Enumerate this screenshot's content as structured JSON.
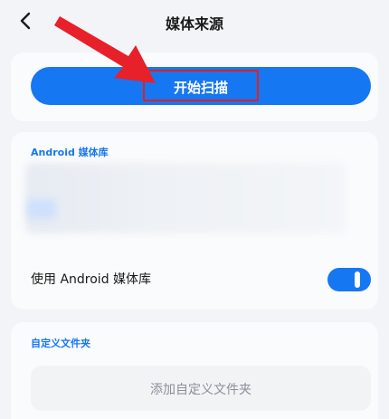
{
  "header": {
    "title": "媒体来源",
    "back_icon": "chevron-left-icon"
  },
  "scan": {
    "button_label": "开始扫描",
    "accent": "#1677f2",
    "highlight_color": "#e02020"
  },
  "android_library": {
    "section_label": "Android 媒体库",
    "toggle_label": "使用 Android 媒体库",
    "toggle_on": true
  },
  "custom_folders": {
    "section_label": "自定义文件夹",
    "add_button_label": "添加自定义文件夹"
  },
  "annotation": {
    "arrow_color": "#e8202a",
    "arrow_icon": "pointer-arrow-icon"
  }
}
